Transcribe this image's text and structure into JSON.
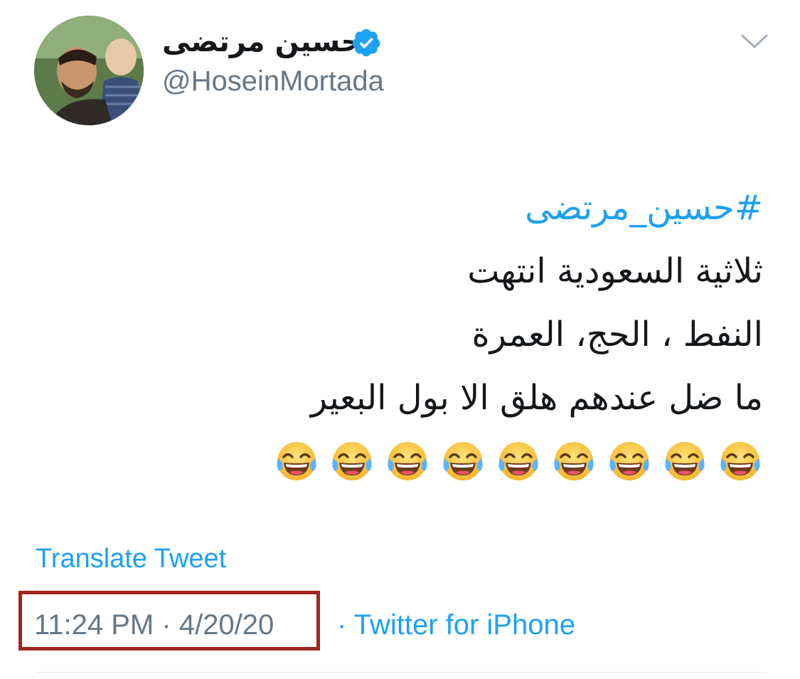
{
  "header": {
    "display_name": "حسين مرتضى",
    "handle": "@HoseinMortada",
    "verified": true,
    "menu_icon": "chevron-down-icon"
  },
  "tweet": {
    "hashtag": "#حسين_مرتضى",
    "lines": [
      "ثلاثية  السعودية انتهت",
      "النفط ، الحج، العمرة",
      "ما ضل عندهم هلق الا بول البعير"
    ],
    "emoji": [
      "face-with-tears-of-joy",
      "face-with-tears-of-joy",
      "face-with-tears-of-joy",
      "face-with-tears-of-joy",
      "face-with-tears-of-joy",
      "face-with-tears-of-joy",
      "face-with-tears-of-joy",
      "face-with-tears-of-joy",
      "face-with-tears-of-joy"
    ]
  },
  "footer": {
    "translate_label": "Translate Tweet",
    "time": "11:24 PM",
    "separator": "·",
    "date": "4/20/20",
    "source": "Twitter for iPhone"
  },
  "colors": {
    "link": "#1da1f2",
    "text": "#14171a",
    "secondary": "#657786",
    "highlight_box": "#a32520"
  }
}
